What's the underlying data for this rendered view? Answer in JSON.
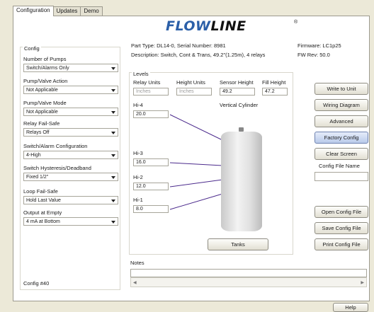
{
  "tabs": [
    "Configuration",
    "Updates",
    "Demo"
  ],
  "logo": {
    "part1": "FLOW",
    "part2": "LINE",
    "mark": "®"
  },
  "info": {
    "part_type": "Part Type: DL14-0, Serial Number: 8981",
    "description": "Description: Switch, Cont & Trans, 49.2\"(1.25m), 4 relays",
    "firmware": "Firmware: LC1p25",
    "fw_rev": "FW Rev: 50.0"
  },
  "config": {
    "title": "Config",
    "fields": [
      {
        "label": "Number of Pumps",
        "value": "Switch/Alarms Only"
      },
      {
        "label": "Pump/Valve Action",
        "value": "Not Applicable"
      },
      {
        "label": "Pump/Valve Mode",
        "value": "Not Applicable"
      },
      {
        "label": "Relay Fail-Safe",
        "value": "Relays Off"
      },
      {
        "label": "Switch/Alarm Configuration",
        "value": "4-High"
      },
      {
        "label": "Switch Hysteresis/Deadband",
        "value": "Fixed 1/2\""
      },
      {
        "label": "Loop Fail-Safe",
        "value": "Hold Last Value"
      },
      {
        "label": "Output at Empty",
        "value": "4 mA at Bottom"
      }
    ],
    "footer": "Config #40"
  },
  "levels": {
    "title": "Levels",
    "relay_units_label": "Relay Units",
    "relay_units_value": "Inches",
    "height_units_label": "Height Units",
    "height_units_value": "Inches",
    "sensor_height_label": "Sensor Height",
    "sensor_height_value": "49.2",
    "fill_height_label": "Fill Height",
    "fill_height_value": "47.2",
    "tank_shape": "Vertical Cylinder",
    "hi4_label": "Hi-4",
    "hi4_value": "20.0",
    "hi3_label": "Hi-3",
    "hi3_value": "16.0",
    "hi2_label": "Hi-2",
    "hi2_value": "12.0",
    "hi1_label": "Hi-1",
    "hi1_value": "8.0",
    "tanks_button": "Tanks"
  },
  "buttons": {
    "write_to_unit": "Write to Unit",
    "wiring_diagram": "Wiring Diagram",
    "advanced": "Advanced",
    "factory_config": "Factory Config",
    "clear_screen": "Clear Screen",
    "config_file_name_label": "Config File Name",
    "config_file_name_value": "",
    "open_config_file": "Open Config File",
    "save_config_file": "Save Config File",
    "print_config_file": "Print Config File"
  },
  "notes": {
    "label": "Notes",
    "value": ""
  },
  "help": "Help"
}
